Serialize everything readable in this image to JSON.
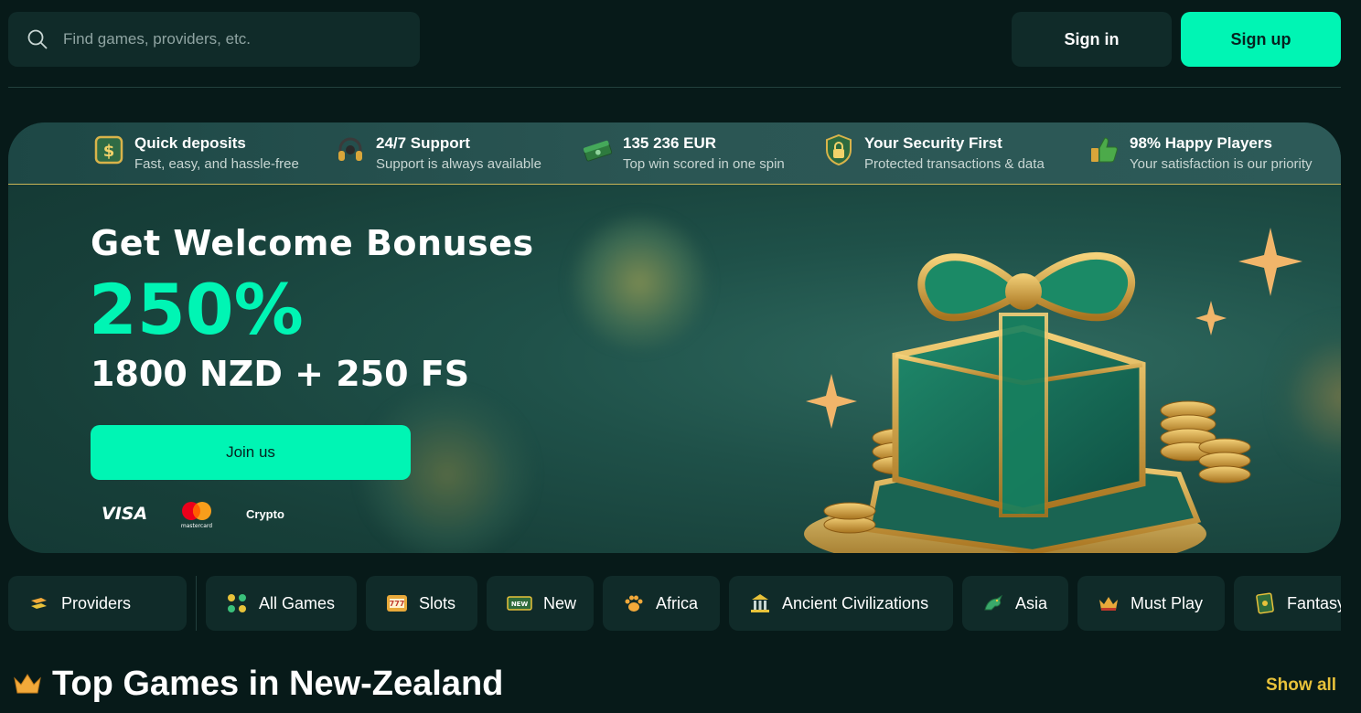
{
  "header": {
    "search_placeholder": "Find games, providers, etc.",
    "signin_label": "Sign in",
    "signup_label": "Sign up"
  },
  "features": [
    {
      "title": "Quick deposits",
      "subtitle": "Fast, easy, and hassle-free",
      "icon": "coin-card-icon"
    },
    {
      "title": "24/7 Support",
      "subtitle": "Support is always available",
      "icon": "headset-icon"
    },
    {
      "title": "135 236 EUR",
      "subtitle": "Top win scored in one spin",
      "icon": "cash-stack-icon"
    },
    {
      "title": "Your Security First",
      "subtitle": "Protected transactions & data",
      "icon": "shield-lock-icon"
    },
    {
      "title": "98% Happy Players",
      "subtitle": "Your satisfaction is our priority",
      "icon": "thumbs-up-icon"
    }
  ],
  "banner": {
    "title": "Get Welcome Bonuses",
    "percent": "250%",
    "amount": "1800 NZD + 250 FS",
    "join_label": "Join us",
    "payments": {
      "visa": "VISA",
      "mastercard": "mastercard",
      "crypto": "Crypto"
    }
  },
  "categories": [
    {
      "label": "Providers",
      "icon": "providers-icon"
    },
    {
      "label": "All Games",
      "icon": "grid-dots-icon"
    },
    {
      "label": "Slots",
      "icon": "slot-777-icon"
    },
    {
      "label": "New",
      "icon": "new-badge-icon"
    },
    {
      "label": "Africa",
      "icon": "paw-icon"
    },
    {
      "label": "Ancient Civilizations",
      "icon": "temple-icon"
    },
    {
      "label": "Asia",
      "icon": "dragon-icon"
    },
    {
      "label": "Must Play",
      "icon": "crown-icon"
    },
    {
      "label": "Fantasy",
      "icon": "card-icon"
    }
  ],
  "top_games": {
    "title": "Top Games in New-Zealand",
    "show_all": "Show all"
  },
  "colors": {
    "accent": "#00f5b4",
    "background": "#071a19",
    "panel": "#102b29",
    "gold": "#e8c23a"
  }
}
